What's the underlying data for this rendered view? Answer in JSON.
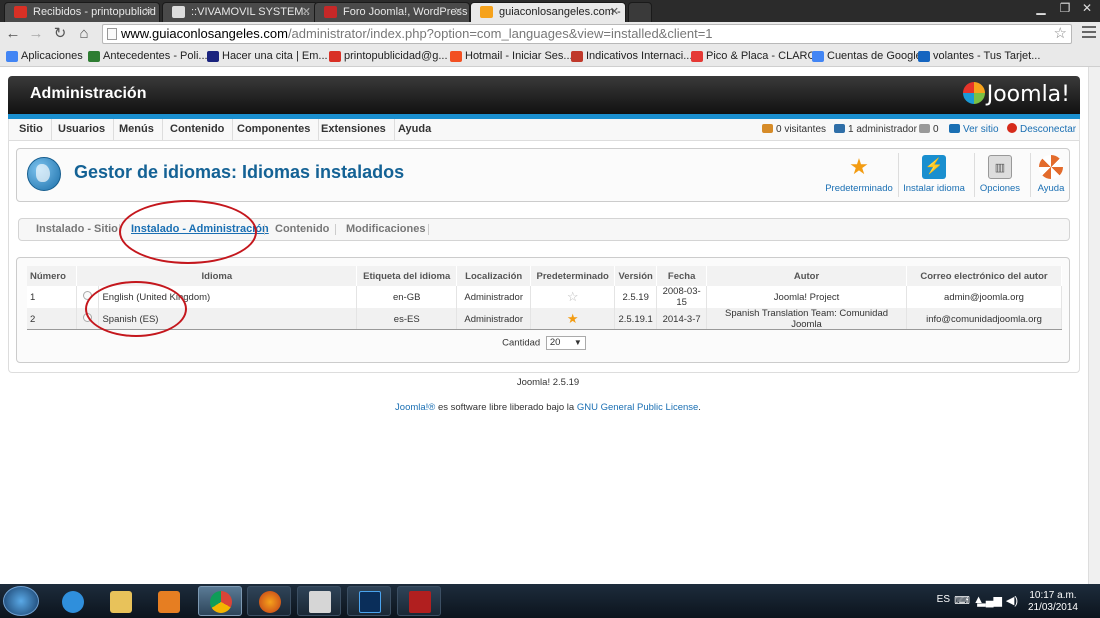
{
  "browser": {
    "tabs": [
      {
        "label": "Recibidos - printopublicid",
        "color": "#d93025"
      },
      {
        "label": "::VIVAMOVIL SYSTEM::",
        "color": "#dddddd"
      },
      {
        "label": "Foro Joomla!, WordPress",
        "color": "#c62828"
      },
      {
        "label": "guiaconlosangeles.com -",
        "color": "#f6a21b"
      }
    ],
    "url_host": "www.guiaconlosangeles.com",
    "url_path": "/administrator/index.php?option=com_languages&view=installed&client=1",
    "bookmarks": [
      {
        "label": "Aplicaciones",
        "color": "#4285f4"
      },
      {
        "label": "Antecedentes - Poli...",
        "color": "#2e7d32"
      },
      {
        "label": "Hacer una cita | Em...",
        "color": "#1a237e"
      },
      {
        "label": "printopublicidad@g...",
        "color": "#d93025"
      },
      {
        "label": "Hotmail - Iniciar Ses...",
        "color": "#f25022"
      },
      {
        "label": "Indicativos Internaci...",
        "color": "#c0392b"
      },
      {
        "label": "Pico & Placa - CLARO",
        "color": "#e53935"
      },
      {
        "label": "Cuentas de Google",
        "color": "#4285f4"
      },
      {
        "label": "volantes - Tus Tarjet...",
        "color": "#1565c0"
      }
    ]
  },
  "admin": {
    "header_title": "Administración",
    "logo_text": "Joomla!",
    "menu": [
      "Sitio",
      "Usuarios",
      "Menús",
      "Contenido",
      "Componentes",
      "Extensiones",
      "Ayuda"
    ],
    "status": {
      "visitors": "0 visitantes",
      "admins": "1 administrador",
      "messages": "0",
      "view_site": "Ver sitio",
      "logout": "Desconectar"
    },
    "page_title": "Gestor de idiomas: Idiomas instalados",
    "toolbar": {
      "default": "Predeterminado",
      "install": "Instalar idioma",
      "options": "Opciones",
      "help": "Ayuda"
    },
    "subtabs": [
      "Instalado - Sitio",
      "Instalado - Administración",
      "Contenido",
      "Modificaciones"
    ],
    "columns": [
      "Número",
      "Idioma",
      "Etiqueta del idioma",
      "Localización",
      "Predeterminado",
      "Versión",
      "Fecha",
      "Autor",
      "Correo electrónico del autor"
    ],
    "rows": [
      {
        "num": "1",
        "language": "English (United Kingdom)",
        "tag": "en-GB",
        "location": "Administrador",
        "is_default": false,
        "version": "2.5.19",
        "date": "2008-03-15",
        "author": "Joomla! Project",
        "email": "admin@joomla.org"
      },
      {
        "num": "2",
        "language": "Spanish (ES)",
        "tag": "es-ES",
        "location": "Administrador",
        "is_default": true,
        "version": "2.5.19.1",
        "date": "2014-3-7",
        "author": "Spanish Translation Team: Comunidad Joomla",
        "email": "info@comunidadjoomla.org"
      }
    ],
    "pagination_label": "Cantidad",
    "pagination_value": "20",
    "footer_version": "Joomla! 2.5.19",
    "footer_license_pre": "Joomla!®",
    "footer_license_mid": " es software libre liberado bajo la ",
    "footer_license_link": "GNU General Public License",
    "footer_license_end": "."
  },
  "taskbar": {
    "lang": "ES",
    "time": "10:17 a.m.",
    "date": "21/03/2014"
  }
}
